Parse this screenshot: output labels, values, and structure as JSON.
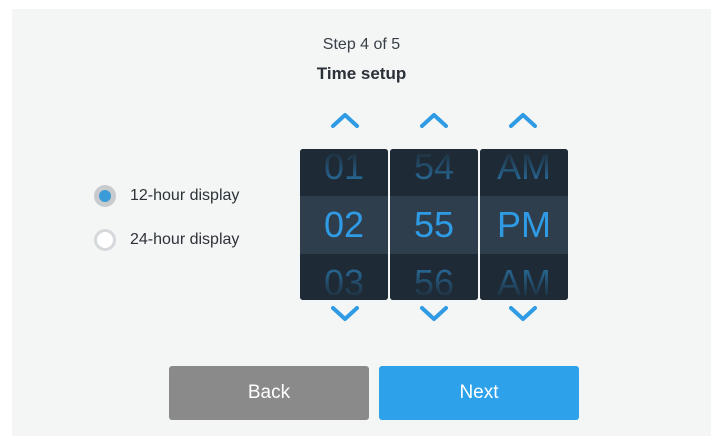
{
  "header": {
    "step": "Step 4 of 5",
    "title": "Time setup"
  },
  "display_mode": {
    "options": [
      {
        "label": "12-hour display",
        "selected": true
      },
      {
        "label": "24-hour display",
        "selected": false
      }
    ]
  },
  "time_picker": {
    "hour": {
      "prev": "01",
      "current": "02",
      "next": "03"
    },
    "minute": {
      "prev": "54",
      "current": "55",
      "next": "56"
    },
    "period": {
      "prev": "AM",
      "current": "PM",
      "next": "AM"
    }
  },
  "buttons": {
    "back_label": "Back",
    "next_label": "Next"
  },
  "colors": {
    "accent": "#2da2ea",
    "picker_bg": "#1e2a35",
    "back_button": "#8a8a8a"
  },
  "icons": {
    "up": "chevron-up-icon",
    "down": "chevron-down-icon"
  }
}
